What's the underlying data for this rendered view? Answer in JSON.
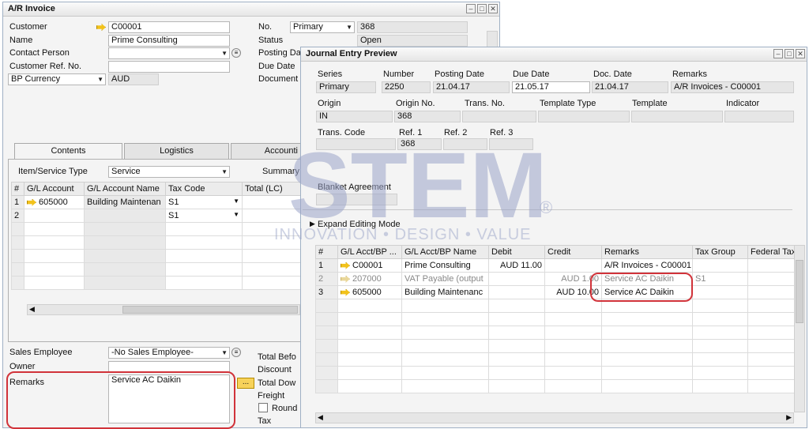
{
  "ar_invoice": {
    "title": "A/R Invoice",
    "customer_label": "Customer",
    "customer_value": "C00001",
    "name_label": "Name",
    "name_value": "Prime Consulting",
    "contact_label": "Contact Person",
    "custref_label": "Customer Ref. No.",
    "currency_select": "BP Currency",
    "currency_value": "AUD",
    "no_label": "No.",
    "no_series": "Primary",
    "no_value": "368",
    "status_label": "Status",
    "status_value": "Open",
    "posting_label": "Posting Da",
    "due_label": "Due Date",
    "document_label": "Document",
    "tabs": [
      "Contents",
      "Logistics",
      "Accounti"
    ],
    "item_type_label": "Item/Service Type",
    "item_type_value": "Service",
    "summary_label": "Summary",
    "grid_headers": [
      "#",
      "G/L Account",
      "G/L Account Name",
      "Tax Code",
      "Total (LC)"
    ],
    "grid_rows": [
      {
        "num": "1",
        "account": "605000",
        "name": "Building Maintenan",
        "tax": "S1"
      },
      {
        "num": "2",
        "account": "",
        "name": "",
        "tax": "S1"
      }
    ],
    "sales_emp_label": "Sales Employee",
    "sales_emp_value": "-No Sales Employee-",
    "owner_label": "Owner",
    "remarks_label": "Remarks",
    "remarks_value": "Service AC Daikin",
    "total_before_label": "Total Befo",
    "discount_label": "Discount",
    "total_down_label": "Total Dow",
    "freight_label": "Freight",
    "rounding_label": "Round",
    "tax_label": "Tax",
    "ellipsis_btn": "..."
  },
  "journal": {
    "title": "Journal Entry Preview",
    "series_label": "Series",
    "series_value": "Primary",
    "number_label": "Number",
    "number_value": "2250",
    "posting_label": "Posting Date",
    "posting_value": "21.04.17",
    "due_label": "Due Date",
    "due_value": "21.05.17",
    "docdate_label": "Doc. Date",
    "docdate_value": "21.04.17",
    "remarks_label": "Remarks",
    "remarks_value": "A/R Invoices - C00001",
    "origin_label": "Origin",
    "origin_value": "IN",
    "originno_label": "Origin No.",
    "originno_value": "368",
    "transno_label": "Trans. No.",
    "template_type_label": "Template Type",
    "template_label": "Template",
    "indicator_label": "Indicator",
    "transcode_label": "Trans. Code",
    "ref1_label": "Ref. 1",
    "ref1_value": "368",
    "ref2_label": "Ref. 2",
    "ref3_label": "Ref. 3",
    "blanket_label": "Blanket Agreement",
    "expand_label": "Expand Editing Mode",
    "grid_headers": [
      "#",
      "G/L Acct/BP ...",
      "G/L Acct/BP Name",
      "Debit",
      "Credit",
      "Remarks",
      "Tax Group",
      "Federal Tax"
    ],
    "grid_rows": [
      {
        "num": "1",
        "acct": "C00001",
        "name": "Prime Consulting",
        "debit": "AUD 11.00",
        "credit": "",
        "remarks": "A/R Invoices - C00001",
        "tax": ""
      },
      {
        "num": "2",
        "acct": "207000",
        "name": "VAT Payable  (output",
        "debit": "",
        "credit": "AUD 1.00",
        "remarks": "Service AC Daikin",
        "tax": "S1"
      },
      {
        "num": "3",
        "acct": "605000",
        "name": "Building Maintenanc",
        "debit": "",
        "credit": "AUD 10.00",
        "remarks": "Service AC Daikin",
        "tax": ""
      }
    ]
  },
  "watermark": {
    "brand": "STEM",
    "tagline": "INNOVATION • DESIGN • VALUE",
    "registered": "®"
  },
  "colors": {
    "highlight": "#d1333a",
    "watermark": "#9aa4c8",
    "arrow": "#f2c21b"
  }
}
